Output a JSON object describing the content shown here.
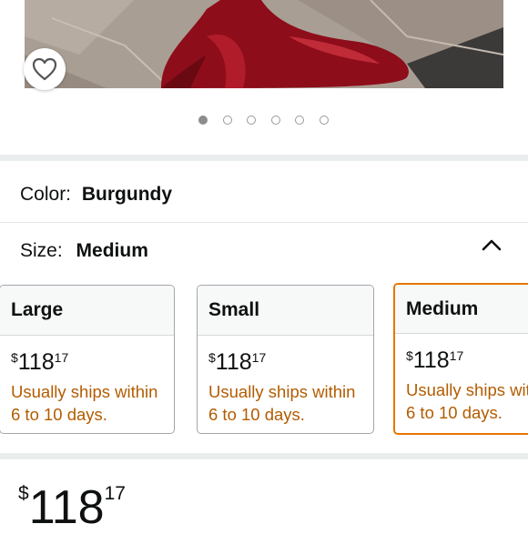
{
  "gallery": {
    "dot_count": 6,
    "active_index": 0,
    "icons": {
      "favorite": "heart-outline-icon"
    }
  },
  "color_row": {
    "label": "Color:",
    "value": "Burgundy"
  },
  "size_row": {
    "label": "Size:",
    "value": "Medium",
    "icon": "chevron-up-icon"
  },
  "size_options": [
    {
      "name": "Large",
      "currency": "$",
      "whole": "118",
      "cents": "17",
      "shipping": [
        "Usually ships within",
        "6 to 10 days."
      ],
      "selected": false
    },
    {
      "name": "Small",
      "currency": "$",
      "whole": "118",
      "cents": "17",
      "shipping": [
        "Usually ships within",
        "6 to 10 days."
      ],
      "selected": false
    },
    {
      "name": "Medium",
      "currency": "$",
      "whole": "118",
      "cents": "17",
      "shipping": [
        "Usually ships wit",
        "6 to 10 days."
      ],
      "selected": true
    }
  ],
  "price": {
    "currency": "$",
    "whole": "118",
    "cents": "17"
  },
  "colors": {
    "accent_selected": "#e77600",
    "shipping_text": "#b35c00",
    "dress": "#8e0d1a"
  }
}
